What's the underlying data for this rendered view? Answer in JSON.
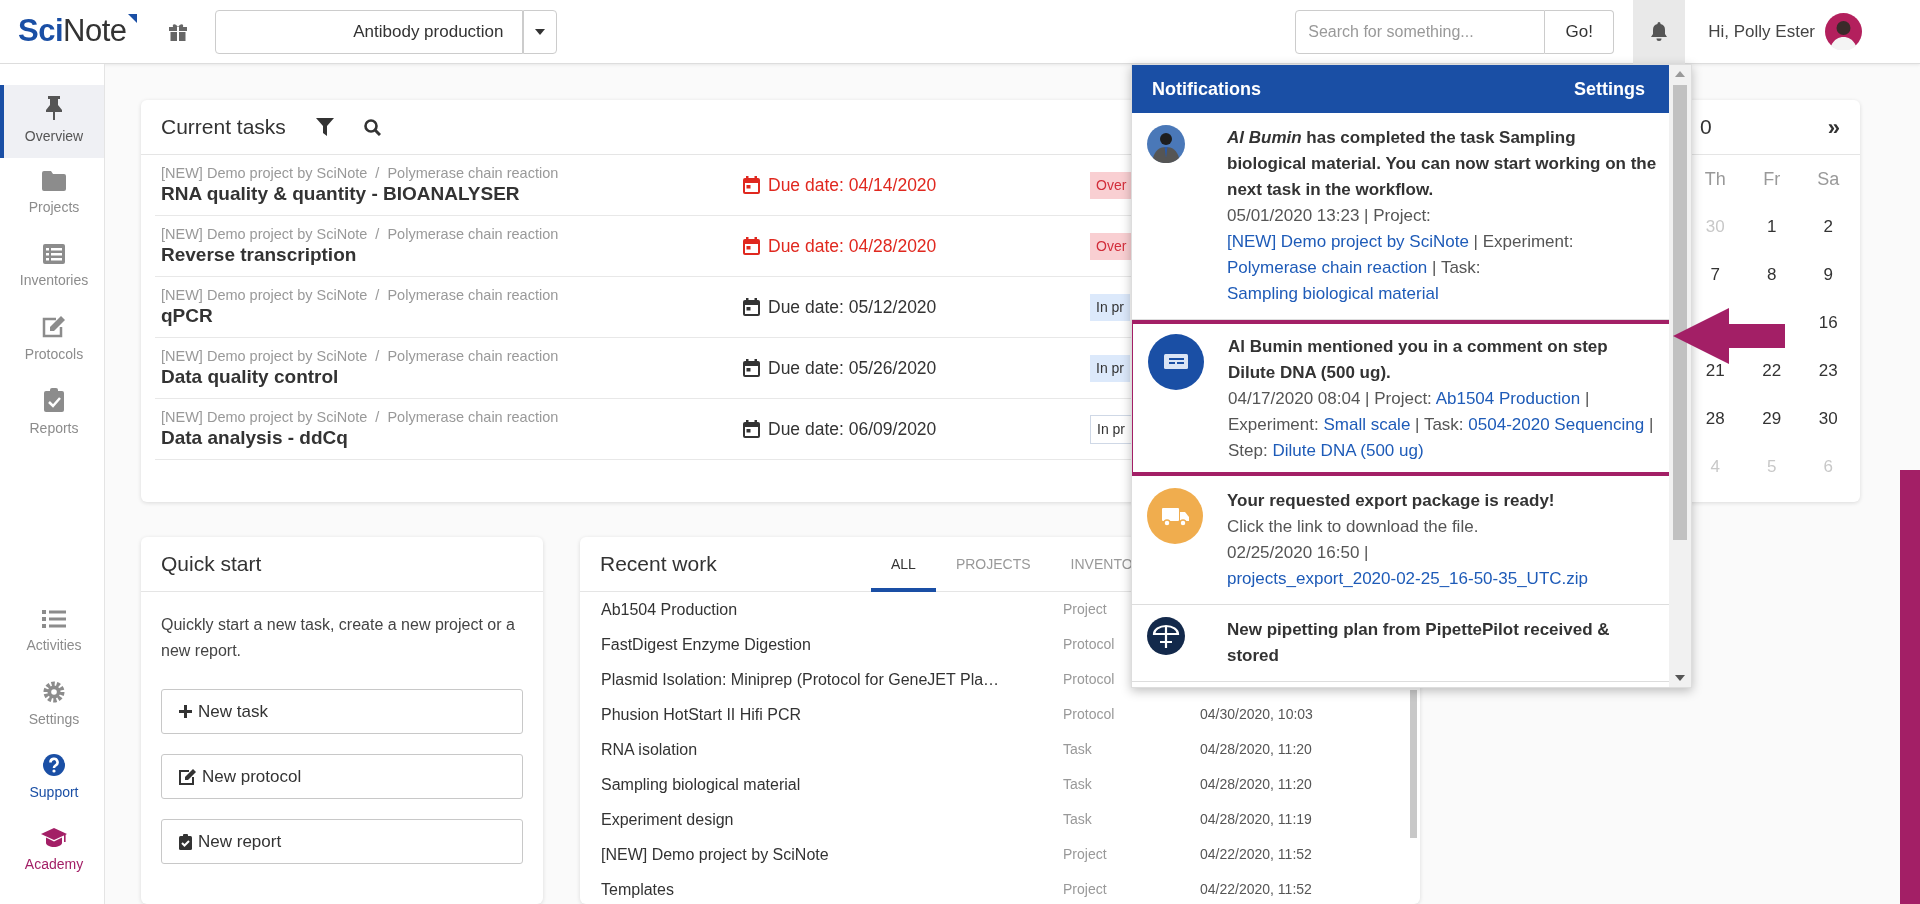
{
  "topbar": {
    "logo": "**Sci**Note",
    "project": "Antibody production",
    "search": {
      "placeholder": "Search for something..."
    },
    "search_button": "Go!",
    "greeting": "Hi, Polly Ester"
  },
  "sidebar": {
    "top_items": [
      {
        "label": "Overview",
        "selected": true,
        "color": "#555555"
      },
      {
        "label": "Projects",
        "selected": false,
        "color": "#8c8c8c"
      },
      {
        "label": "Inventories",
        "selected": false,
        "color": "#8c8c8c"
      },
      {
        "label": "Protocols",
        "selected": false,
        "color": "#8c8c8c"
      },
      {
        "label": "Reports",
        "selected": false,
        "color": "#8c8c8c"
      }
    ],
    "bottom_items": [
      {
        "label": "Activities",
        "selected": false,
        "color": "#8c8c8c"
      },
      {
        "label": "Settings",
        "selected": false,
        "color": "#8c8c8c"
      },
      {
        "label": "Support",
        "selected": false,
        "color": "#1a4fa5"
      },
      {
        "label": "Academy",
        "selected": false,
        "color": "#a31f66"
      }
    ]
  },
  "current_tasks": {
    "title": "Current tasks",
    "rows": [
      {
        "breadcrumb": "[NEW] Demo project by SciNote  /  Polymerase chain reaction",
        "name": "RNA quality & quantity - BIOANALYSER",
        "due": "Due date: 04/14/2020",
        "overdue": true,
        "status": "Over",
        "kind": "overdue"
      },
      {
        "breadcrumb": "[NEW] Demo project by SciNote  /  Polymerase chain reaction",
        "name": "Reverse transcription",
        "due": "Due date: 04/28/2020",
        "overdue": true,
        "status": "Over",
        "kind": "overdue"
      },
      {
        "breadcrumb": "[NEW] Demo project by SciNote  /  Polymerase chain reaction",
        "name": "qPCR",
        "due": "Due date: 05/12/2020",
        "overdue": false,
        "status": "In pr",
        "kind": "progress"
      },
      {
        "breadcrumb": "[NEW] Demo project by SciNote  /  Polymerase chain reaction",
        "name": "Data quality control",
        "due": "Due date: 05/26/2020",
        "overdue": false,
        "status": "In pr",
        "kind": "progress"
      },
      {
        "breadcrumb": "[NEW] Demo project by SciNote  /  Polymerase chain reaction",
        "name": "Data analysis - ddCq",
        "due": "Due date: 06/09/2020",
        "overdue": false,
        "status": "In pr",
        "kind": "outline"
      }
    ]
  },
  "calendar": {
    "title": "0",
    "next": "»",
    "weekdays": [
      "Th",
      "Fr",
      "Sa"
    ],
    "weeks": [
      {
        "th": {
          "day": "30",
          "muted": true
        },
        "fr": {
          "day": "1",
          "muted": false
        },
        "sa": {
          "day": "2",
          "muted": false
        }
      },
      {
        "th": {
          "day": "7",
          "muted": false
        },
        "fr": {
          "day": "8",
          "muted": false
        },
        "sa": {
          "day": "9",
          "muted": false
        }
      },
      {
        "sa": {
          "day": "16",
          "muted": false
        }
      },
      {
        "th": {
          "day": "21",
          "muted": false
        },
        "fr": {
          "day": "22",
          "muted": false
        },
        "sa": {
          "day": "23",
          "muted": false
        }
      },
      {
        "th": {
          "day": "28",
          "muted": false
        },
        "fr": {
          "day": "29",
          "muted": false
        },
        "sa": {
          "day": "30",
          "muted": false
        }
      },
      {
        "th": {
          "day": "4",
          "muted": true
        },
        "fr": {
          "day": "5",
          "muted": true
        },
        "sa": {
          "day": "6",
          "muted": true
        }
      }
    ]
  },
  "quick_start": {
    "title": "Quick start",
    "text": "Quickly start a new task, create a new project or a new report.",
    "buttons": [
      "New task",
      "New protocol",
      "New report"
    ]
  },
  "recent_work": {
    "title": "Recent work",
    "tabs": [
      {
        "label": "ALL",
        "selected": true
      },
      {
        "label": "PROJECTS",
        "selected": false
      },
      {
        "label": "INVENTO",
        "selected": false
      }
    ],
    "rows": [
      {
        "name": "Ab1504 Production",
        "type": "Project"
      },
      {
        "name": "FastDigest Enzyme Digestion",
        "type": "Protocol"
      },
      {
        "name": "Plasmid Isolation: Miniprep (Protocol for GeneJET Pla…",
        "type": "Protocol"
      },
      {
        "name": "Phusion HotStart II Hifi PCR",
        "type": "Protocol",
        "date": "04/30/2020, 10:03"
      },
      {
        "name": "RNA isolation",
        "type": "Task",
        "date": "04/28/2020, 11:20"
      },
      {
        "name": "Sampling biological material",
        "type": "Task",
        "date": "04/28/2020, 11:20"
      },
      {
        "name": "Experiment design",
        "type": "Task",
        "date": "04/28/2020, 11:19"
      },
      {
        "name": "[NEW] Demo project by SciNote",
        "type": "Project",
        "date": "04/22/2020, 11:52"
      },
      {
        "name": "Templates",
        "type": "Project",
        "date": "04/22/2020, 11:52"
      }
    ]
  },
  "notifications": {
    "title": "Notifications",
    "settings": "Settings",
    "items": [
      {
        "kind": "avatar",
        "highlighted": false,
        "title": "*Al Bumin* has completed the task Sampling biological material. You can now start working on the next task in the workflow.",
        "meta": [
          {
            "text": "05/01/2020 13:23 | Project: "
          },
          {
            "text": "[NEW] Demo project by SciNote",
            "link": true
          },
          {
            "text": " | Experiment: "
          },
          {
            "text": "Polymerase chain reaction",
            "link": true
          },
          {
            "text": " | Task: "
          },
          {
            "text": "Sampling biological material",
            "link": true
          }
        ]
      },
      {
        "kind": "comment",
        "highlighted": true,
        "title": "Al Bumin mentioned you in a comment on step Dilute DNA (500 ug).",
        "meta": [
          {
            "text": "04/17/2020 08:04 | Project: "
          },
          {
            "text": "Ab1504 Production",
            "link": true
          },
          {
            "text": " | Experiment: "
          },
          {
            "text": "Small scale",
            "link": true
          },
          {
            "text": " | Task: "
          },
          {
            "text": "0504-2020 Sequencing",
            "link": true
          },
          {
            "text": " | Step: "
          },
          {
            "text": "Dilute DNA (500 ug)",
            "link": true
          }
        ]
      },
      {
        "kind": "export",
        "highlighted": false,
        "title": "Your requested export package is ready!",
        "subtitle": "Click the link to download the file.",
        "meta": [
          {
            "text": "02/25/2020 16:50 | "
          },
          {
            "text": "projects_export_2020-02-25_16-50-35_UTC.zip",
            "link": true
          }
        ]
      },
      {
        "kind": "pipette",
        "highlighted": false,
        "title": "New pipetting plan from PipettePilot received & stored"
      }
    ]
  },
  "callout_arrow": true
}
